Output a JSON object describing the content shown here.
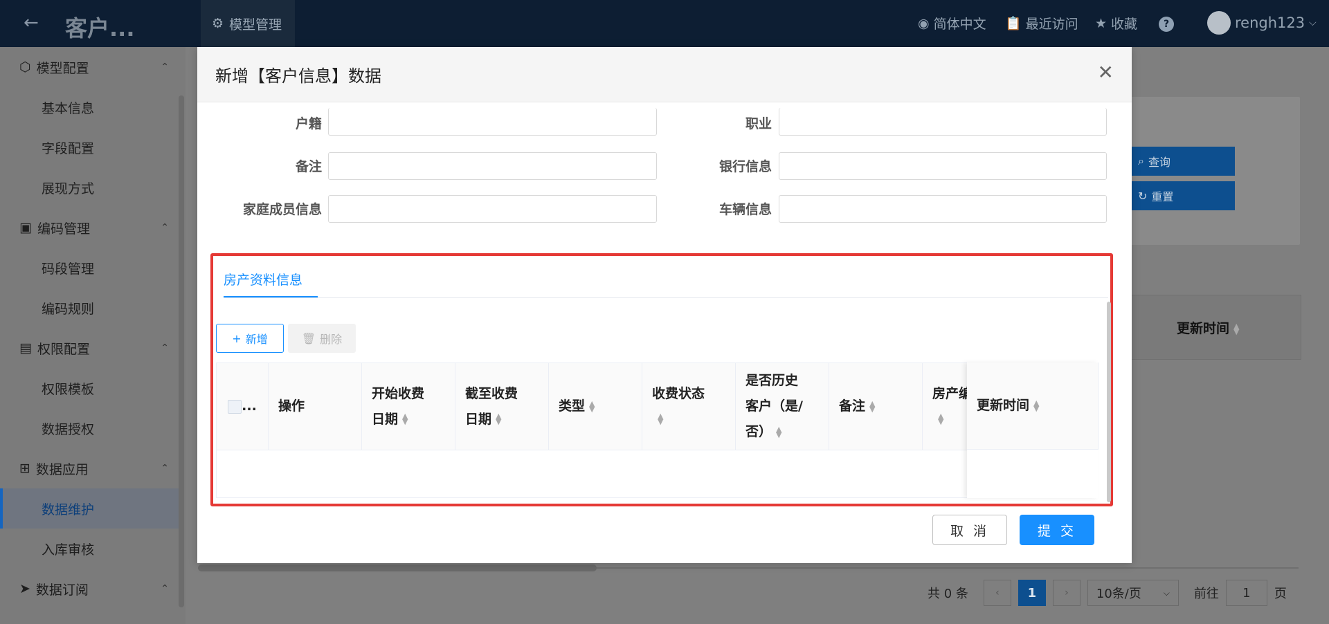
{
  "header": {
    "back_icon": "arrow-left-icon",
    "app_title": "客户...",
    "top_tab": "模型管理",
    "language": "简体中文",
    "recent": "最近访问",
    "favorites": "收藏",
    "user": "rengh123"
  },
  "sidebar": {
    "groups": [
      {
        "label": "模型配置",
        "items": [
          "基本信息",
          "字段配置",
          "展现方式"
        ]
      },
      {
        "label": "编码管理",
        "items": [
          "码段管理",
          "编码规则"
        ]
      },
      {
        "label": "权限配置",
        "items": [
          "权限模板",
          "数据授权"
        ]
      },
      {
        "label": "数据应用",
        "items": [
          "数据维护",
          "入库审核"
        ]
      },
      {
        "label": "数据订阅",
        "items": []
      }
    ],
    "active_item": "数据维护"
  },
  "background": {
    "query_button": "查询",
    "reset_button": "重置",
    "update_time_header": "更新时间",
    "pagination": {
      "total": "共 0 条",
      "current_page": "1",
      "page_size": "10条/页",
      "goto_label": "前往",
      "goto_value": "1",
      "page_suffix": "页"
    }
  },
  "modal": {
    "title": "新增【客户信息】数据",
    "fields": {
      "huji": "户籍",
      "zhiye": "职业",
      "beizhu": "备注",
      "yinhang": "银行信息",
      "jiating": "家庭成员信息",
      "cheliang": "车辆信息"
    },
    "tab_label": "房产资料信息",
    "add_button": "新增",
    "delete_button": "删除",
    "table_headers": {
      "select": "...",
      "op": "操作",
      "start_a": "开始收费",
      "start_b": "日期",
      "end_a": "截至收费",
      "end_b": "日期",
      "type": "类型",
      "status": "收费状态",
      "hist_a": "是否历史",
      "hist_b": "客户（是/",
      "hist_c": "否）",
      "remark": "备注",
      "house": "房产编",
      "update": "更新时间"
    },
    "cancel_button": "取 消",
    "submit_button": "提 交"
  },
  "colors": {
    "primary": "#1890ff",
    "highlight": "#e53935",
    "header_bg": "#0d1e33"
  }
}
